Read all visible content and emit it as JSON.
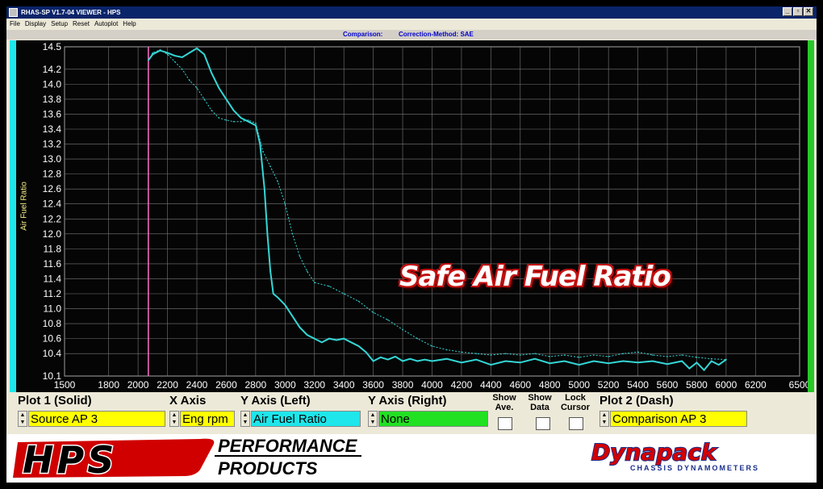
{
  "window": {
    "title": "RHAS-SP V1.7-04  VIEWER - HPS",
    "minimize": "_",
    "restore": "▫",
    "close": "✕"
  },
  "menu": [
    "File",
    "Display",
    "Setup",
    "Reset",
    "Autoplot",
    "Help"
  ],
  "info": {
    "comparison": "Comparison:",
    "correction": "Correction-Method: SAE"
  },
  "overlay_text": "Safe Air Fuel Ratio",
  "controls": {
    "plot1_label": "Plot 1 (Solid)",
    "plot1_value": "Source AP 3",
    "xaxis_label": "X Axis",
    "xaxis_value": "Eng rpm",
    "yleft_label": "Y Axis (Left)",
    "yleft_value": "Air Fuel Ratio",
    "yright_label": "Y Axis (Right)",
    "yright_value": "None",
    "show_ave_1": "Show",
    "show_ave_2": "Ave.",
    "show_data_1": "Show",
    "show_data_2": "Data",
    "lock_cursor_1": "Lock",
    "lock_cursor_2": "Cursor",
    "plot2_label": "Plot 2 (Dash)",
    "plot2_value": "Comparison AP 3"
  },
  "footer": {
    "hps_logo": "HPS",
    "hps_tagline_1": "PERFORMANCE",
    "hps_tagline_2": "PRODUCTS",
    "dynapack_logo": "Dynapack",
    "dynapack_tagline": "CHASSIS DYNAMOMETERS"
  },
  "colors": {
    "plot_background": "#050505",
    "solid_series": "#35d6d6",
    "dash_series": "#35d6d6",
    "cursor": "#ff6ec7",
    "axis_text": "#ffffff",
    "ylabel_text": "#f5f28a",
    "plot1_field": "#ffff00",
    "yleft_field": "#1ee6ea",
    "yright_field": "#22e022",
    "left_bar": "#1ee6ea",
    "right_bar": "#28c828"
  },
  "chart_data": {
    "type": "line",
    "xlabel": "",
    "ylabel": "Air Fuel Ratio",
    "xlim": [
      1500,
      6500
    ],
    "ylim": [
      10.1,
      14.5
    ],
    "x_ticks": [
      "1500",
      "1800",
      "2000",
      "2200",
      "2400",
      "2600",
      "2800",
      "3000",
      "3200",
      "3400",
      "3600",
      "3800",
      "4000",
      "4200",
      "4400",
      "4600",
      "4800",
      "5000",
      "5200",
      "5400",
      "5600",
      "5800",
      "6000",
      "6200",
      "6500"
    ],
    "y_ticks": [
      "10.1",
      "10.4",
      "10.6",
      "10.8",
      "11.0",
      "11.2",
      "11.4",
      "11.6",
      "11.8",
      "12.0",
      "12.2",
      "12.4",
      "12.6",
      "12.8",
      "13.0",
      "13.2",
      "13.4",
      "13.6",
      "13.8",
      "14.0",
      "14.2",
      "14.5"
    ],
    "grid": true,
    "cursor_x": 2070,
    "series": [
      {
        "style": "solid",
        "x": [
          2070,
          2100,
          2150,
          2200,
          2250,
          2300,
          2350,
          2400,
          2450,
          2500,
          2550,
          2600,
          2650,
          2700,
          2750,
          2800,
          2830,
          2860,
          2880,
          2900,
          2920,
          2950,
          3000,
          3050,
          3100,
          3150,
          3200,
          3250,
          3300,
          3350,
          3400,
          3450,
          3500,
          3550,
          3600,
          3650,
          3700,
          3750,
          3800,
          3850,
          3900,
          3950,
          4000,
          4100,
          4200,
          4300,
          4400,
          4500,
          4600,
          4700,
          4800,
          4900,
          5000,
          5100,
          5200,
          5300,
          5400,
          5500,
          5600,
          5700,
          5750,
          5800,
          5850,
          5900,
          5950,
          6000
        ],
        "y": [
          14.32,
          14.4,
          14.45,
          14.42,
          14.38,
          14.36,
          14.42,
          14.48,
          14.4,
          14.15,
          13.95,
          13.8,
          13.65,
          13.55,
          13.5,
          13.45,
          13.2,
          12.6,
          12.0,
          11.5,
          11.2,
          11.15,
          11.05,
          10.9,
          10.75,
          10.65,
          10.6,
          10.55,
          10.6,
          10.58,
          10.6,
          10.55,
          10.5,
          10.42,
          10.3,
          10.35,
          10.32,
          10.36,
          10.3,
          10.33,
          10.3,
          10.32,
          10.3,
          10.33,
          10.28,
          10.32,
          10.25,
          10.3,
          10.28,
          10.33,
          10.27,
          10.3,
          10.25,
          10.3,
          10.27,
          10.3,
          10.28,
          10.3,
          10.26,
          10.3,
          10.2,
          10.28,
          10.18,
          10.3,
          10.25,
          10.32
        ]
      },
      {
        "style": "dash",
        "x": [
          2070,
          2100,
          2150,
          2200,
          2250,
          2300,
          2350,
          2400,
          2450,
          2500,
          2550,
          2600,
          2650,
          2700,
          2750,
          2800,
          2850,
          2900,
          2950,
          3000,
          3050,
          3100,
          3150,
          3200,
          3300,
          3400,
          3500,
          3600,
          3700,
          3800,
          3900,
          4000,
          4100,
          4200,
          4300,
          4400,
          4500,
          4600,
          4700,
          4800,
          4900,
          5000,
          5100,
          5200,
          5300,
          5400,
          5500,
          5600,
          5700,
          5800,
          5900,
          6000
        ],
        "y": [
          14.32,
          14.42,
          14.46,
          14.4,
          14.3,
          14.2,
          14.05,
          13.95,
          13.8,
          13.65,
          13.55,
          13.52,
          13.5,
          13.5,
          13.52,
          13.48,
          13.1,
          12.9,
          12.7,
          12.4,
          12.0,
          11.7,
          11.5,
          11.35,
          11.3,
          11.2,
          11.1,
          10.95,
          10.85,
          10.72,
          10.6,
          10.5,
          10.45,
          10.42,
          10.4,
          10.38,
          10.4,
          10.38,
          10.4,
          10.36,
          10.38,
          10.35,
          10.38,
          10.36,
          10.4,
          10.42,
          10.38,
          10.36,
          10.38,
          10.35,
          10.33,
          10.32
        ]
      }
    ]
  }
}
